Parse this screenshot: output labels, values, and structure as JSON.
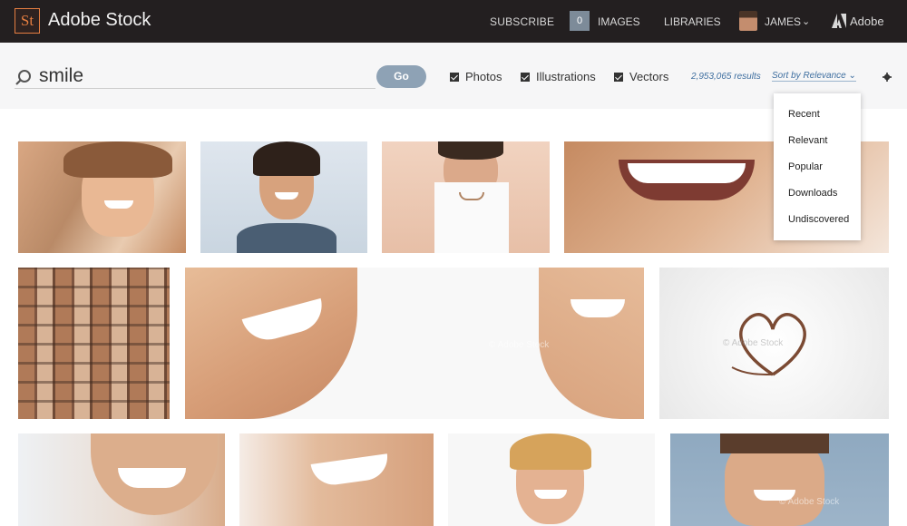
{
  "header": {
    "logo_text": "St",
    "brand": "Adobe Stock",
    "nav": {
      "subscribe": "SUBSCRIBE",
      "images_count": "0",
      "images": "IMAGES",
      "libraries": "LIBRARIES"
    },
    "user": {
      "name": "JAMES",
      "chevron": "⌄"
    },
    "adobe": "Adobe"
  },
  "search": {
    "value": "smile",
    "go_label": "Go",
    "filters": [
      {
        "label": "Photos",
        "checked": true
      },
      {
        "label": "Illustrations",
        "checked": true
      },
      {
        "label": "Vectors",
        "checked": true
      }
    ],
    "results": "2,953,065 results",
    "sort_label": "Sort by Relevance ⌄"
  },
  "sort_menu": {
    "options": [
      "Recent",
      "Relevant",
      "Popular",
      "Downloads",
      "Undiscovered"
    ]
  },
  "watermark": "© Adobe Stock",
  "icons": {
    "search": "search-icon",
    "gear": "gear-icon",
    "adobe": "adobe-logo-icon"
  },
  "colors": {
    "topbar": "#231f20",
    "logo_accent": "#e57e41",
    "link_blue": "#3f6fa0",
    "go_button": "#8ea2b5"
  }
}
